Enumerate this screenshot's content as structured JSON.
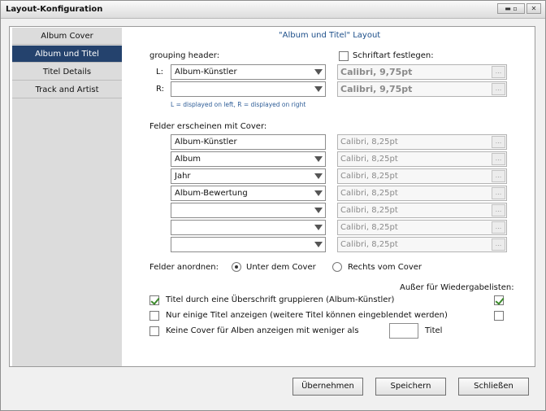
{
  "window": {
    "title": "Layout-Konfiguration"
  },
  "titlebar_buttons": {
    "minmax": "▬ ▫",
    "close": "✕"
  },
  "sidebar": {
    "items": [
      {
        "label": "Album Cover"
      },
      {
        "label": "Album und Titel",
        "active": true
      },
      {
        "label": "Titel Details"
      },
      {
        "label": "Track and Artist"
      }
    ]
  },
  "main": {
    "heading": "\"Album und Titel\" Layout",
    "grouping_label": "grouping header:",
    "left_prefix": "L:",
    "right_prefix": "R:",
    "grouping_left_value": "Album-Künstler",
    "grouping_right_value": "",
    "lr_note": "L = displayed on left, R = displayed on right",
    "font_checkbox_label": "Schriftart festlegen:",
    "font_checkbox_checked": false,
    "grouping_font_left": "Calibri, 9,75pt",
    "grouping_font_right": "Calibri, 9,75pt",
    "fields_label": "Felder erscheinen mit Cover:",
    "fields": [
      {
        "value": "Album-Künstler",
        "font": "Calibri, 8,25pt"
      },
      {
        "value": "Album",
        "font": "Calibri, 8,25pt"
      },
      {
        "value": "Jahr",
        "font": "Calibri, 8,25pt"
      },
      {
        "value": "Album-Bewertung",
        "font": "Calibri, 8,25pt"
      },
      {
        "value": "",
        "font": "Calibri, 8,25pt"
      },
      {
        "value": "",
        "font": "Calibri, 8,25pt"
      },
      {
        "value": "",
        "font": "Calibri, 8,25pt"
      }
    ],
    "dots": "...",
    "arrange_label": "Felder anordnen:",
    "arrange_options": [
      {
        "label": "Unter dem Cover",
        "selected": true
      },
      {
        "label": "Rechts vom Cover",
        "selected": false
      }
    ],
    "except_playlists_label": "Außer für Wiedergabelisten:",
    "options": [
      {
        "label": "Titel durch eine Überschrift gruppieren (Album-Künstler)",
        "checked": true,
        "playlist_checked": true
      },
      {
        "label": "Nur einige Titel anzeigen (weitere Titel können eingeblendet werden)",
        "checked": false,
        "playlist_checked": false
      },
      {
        "label": "Keine Cover für Alben anzeigen mit weniger als",
        "checked": false,
        "suffix": "Titel",
        "count_value": ""
      }
    ]
  },
  "buttons": {
    "apply": "Übernehmen",
    "save": "Speichern",
    "close": "Schließen"
  }
}
